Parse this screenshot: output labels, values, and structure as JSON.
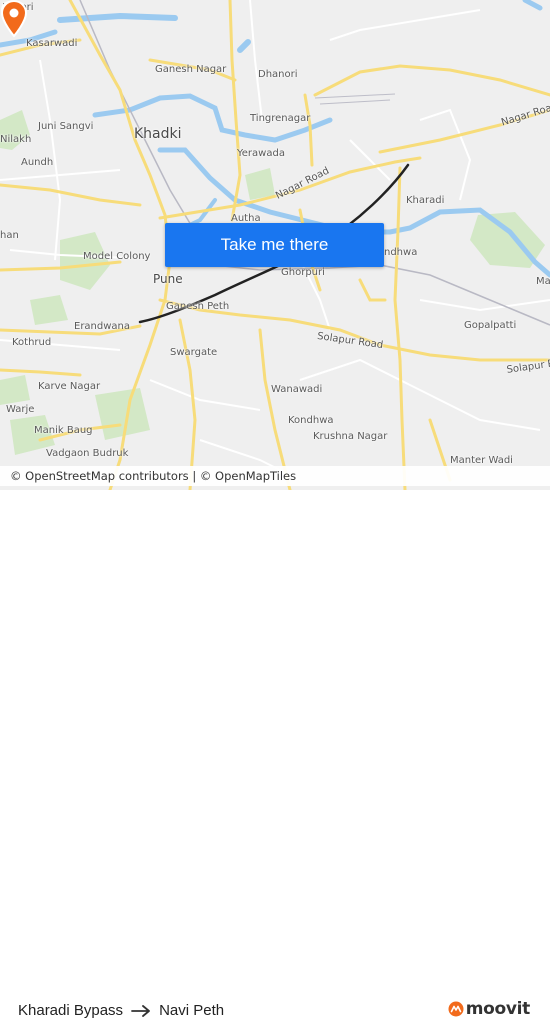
{
  "map": {
    "labels": {
      "pimpri": "Pimpri",
      "kasarwadi": "Kasarwadi",
      "ganesh_nagar": "Ganesh Nagar",
      "dhanori": "Dhanori",
      "tingrenagar": "Tingrenagar",
      "juni_sangvi": "Juni Sangvi",
      "khadki": "Khadki",
      "nilakh": "Nilakh",
      "aundh": "Aundh",
      "yerawada": "Yerawada",
      "nagar_road_1": "Nagar Road",
      "nagar_road_2": "Nagar Road",
      "kharadi": "Kharadi",
      "ndhwa": "ndhwa",
      "model_colony": "Model Colony",
      "pune": "Pune",
      "ghorpuri": "Ghorpuri",
      "ganesh_peth": "Ganesh Peth",
      "erandwana": "Erandwana",
      "gopalpatti": "Gopalpatti",
      "kothrud": "Kothrud",
      "swargate": "Swargate",
      "solapur_road_1": "Solapur Road",
      "solapur_road_2": "Solapur Road",
      "karve_nagar": "Karve Nagar",
      "wanawadi": "Wanawadi",
      "warje": "Warje",
      "kondhwa": "Kondhwa",
      "krushna_nagar": "Krushna Nagar",
      "manik_baug": "Manik Baug",
      "vadgaon_budruk": "Vadgaon Budruk",
      "manter_wadi": "Manter Wadi",
      "ma": "Ma",
      "han": "han",
      "autha": "Autha"
    },
    "cta_label": "Take me there",
    "attribution": "© OpenStreetMap contributors | © OpenMapTiles",
    "colors": {
      "route": "#222222",
      "origin": "#2f7df6",
      "destination": "#f26a1b",
      "water": "#8fc3ee",
      "park": "#cfe6c4",
      "major_road": "#f7dc7a"
    }
  },
  "footer": {
    "origin": "Kharadi Bypass",
    "destination": "Navi Peth",
    "brand": "moovit",
    "arrow_icon": "right-arrow-icon",
    "logo_icon": "moovit-logo-icon"
  }
}
